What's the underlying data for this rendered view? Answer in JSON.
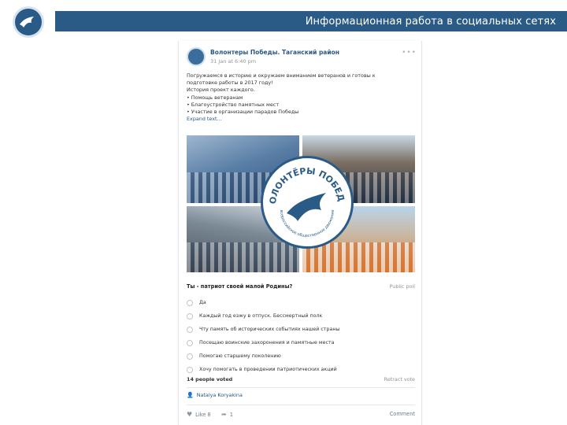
{
  "slide": {
    "title": "Информационная работа в социальных сетях"
  },
  "post": {
    "group_name": "Волонтеры Победы. Таганский район",
    "group_date": "31 Jan at 6:40 pm",
    "text_lines": [
      "Погружаемся в историю и окружаем вниманием ветеранов и готовы к",
      "подготовке работы в 2017 году!",
      "История проект каждого.",
      "• Помощь ветеранам",
      "• Благоустройство памятных мест",
      "• Участие в организации парадов Победы"
    ],
    "expand_label": "Expand text...",
    "emblem_top_text": "ВОЛОНТЁРЫ ПОБЕДЫ",
    "emblem_bottom_text": "всероссийское общественное движение"
  },
  "poll": {
    "question": "Ты - патриот своей малой Родины?",
    "type_label": "Public poll",
    "options": [
      "Да",
      "Каждый год езжу в отпуск. Бессмертный полк",
      "Чту память об исторических событиях нашей страны",
      "Посещаю воинские захоронения и памятные места",
      "Помогаю старшему поколению",
      "Хочу помогать в проведении патриотических акций"
    ],
    "votes": "14 people voted",
    "revote_label": "Retract vote",
    "author": "Natalya Koryakina"
  },
  "actions": {
    "likes": "Like 8",
    "shares": "1",
    "comment": "Comment"
  },
  "colors": {
    "brand": "#2a5b86",
    "link": "#2a5885"
  }
}
